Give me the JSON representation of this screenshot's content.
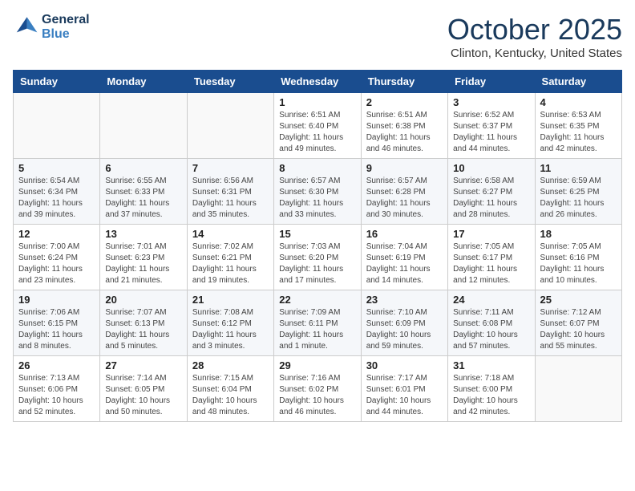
{
  "logo": {
    "line1": "General",
    "line2": "Blue"
  },
  "title": "October 2025",
  "subtitle": "Clinton, Kentucky, United States",
  "weekdays": [
    "Sunday",
    "Monday",
    "Tuesday",
    "Wednesday",
    "Thursday",
    "Friday",
    "Saturday"
  ],
  "weeks": [
    [
      {
        "day": "",
        "info": ""
      },
      {
        "day": "",
        "info": ""
      },
      {
        "day": "",
        "info": ""
      },
      {
        "day": "1",
        "info": "Sunrise: 6:51 AM\nSunset: 6:40 PM\nDaylight: 11 hours\nand 49 minutes."
      },
      {
        "day": "2",
        "info": "Sunrise: 6:51 AM\nSunset: 6:38 PM\nDaylight: 11 hours\nand 46 minutes."
      },
      {
        "day": "3",
        "info": "Sunrise: 6:52 AM\nSunset: 6:37 PM\nDaylight: 11 hours\nand 44 minutes."
      },
      {
        "day": "4",
        "info": "Sunrise: 6:53 AM\nSunset: 6:35 PM\nDaylight: 11 hours\nand 42 minutes."
      }
    ],
    [
      {
        "day": "5",
        "info": "Sunrise: 6:54 AM\nSunset: 6:34 PM\nDaylight: 11 hours\nand 39 minutes."
      },
      {
        "day": "6",
        "info": "Sunrise: 6:55 AM\nSunset: 6:33 PM\nDaylight: 11 hours\nand 37 minutes."
      },
      {
        "day": "7",
        "info": "Sunrise: 6:56 AM\nSunset: 6:31 PM\nDaylight: 11 hours\nand 35 minutes."
      },
      {
        "day": "8",
        "info": "Sunrise: 6:57 AM\nSunset: 6:30 PM\nDaylight: 11 hours\nand 33 minutes."
      },
      {
        "day": "9",
        "info": "Sunrise: 6:57 AM\nSunset: 6:28 PM\nDaylight: 11 hours\nand 30 minutes."
      },
      {
        "day": "10",
        "info": "Sunrise: 6:58 AM\nSunset: 6:27 PM\nDaylight: 11 hours\nand 28 minutes."
      },
      {
        "day": "11",
        "info": "Sunrise: 6:59 AM\nSunset: 6:25 PM\nDaylight: 11 hours\nand 26 minutes."
      }
    ],
    [
      {
        "day": "12",
        "info": "Sunrise: 7:00 AM\nSunset: 6:24 PM\nDaylight: 11 hours\nand 23 minutes."
      },
      {
        "day": "13",
        "info": "Sunrise: 7:01 AM\nSunset: 6:23 PM\nDaylight: 11 hours\nand 21 minutes."
      },
      {
        "day": "14",
        "info": "Sunrise: 7:02 AM\nSunset: 6:21 PM\nDaylight: 11 hours\nand 19 minutes."
      },
      {
        "day": "15",
        "info": "Sunrise: 7:03 AM\nSunset: 6:20 PM\nDaylight: 11 hours\nand 17 minutes."
      },
      {
        "day": "16",
        "info": "Sunrise: 7:04 AM\nSunset: 6:19 PM\nDaylight: 11 hours\nand 14 minutes."
      },
      {
        "day": "17",
        "info": "Sunrise: 7:05 AM\nSunset: 6:17 PM\nDaylight: 11 hours\nand 12 minutes."
      },
      {
        "day": "18",
        "info": "Sunrise: 7:05 AM\nSunset: 6:16 PM\nDaylight: 11 hours\nand 10 minutes."
      }
    ],
    [
      {
        "day": "19",
        "info": "Sunrise: 7:06 AM\nSunset: 6:15 PM\nDaylight: 11 hours\nand 8 minutes."
      },
      {
        "day": "20",
        "info": "Sunrise: 7:07 AM\nSunset: 6:13 PM\nDaylight: 11 hours\nand 5 minutes."
      },
      {
        "day": "21",
        "info": "Sunrise: 7:08 AM\nSunset: 6:12 PM\nDaylight: 11 hours\nand 3 minutes."
      },
      {
        "day": "22",
        "info": "Sunrise: 7:09 AM\nSunset: 6:11 PM\nDaylight: 11 hours\nand 1 minute."
      },
      {
        "day": "23",
        "info": "Sunrise: 7:10 AM\nSunset: 6:09 PM\nDaylight: 10 hours\nand 59 minutes."
      },
      {
        "day": "24",
        "info": "Sunrise: 7:11 AM\nSunset: 6:08 PM\nDaylight: 10 hours\nand 57 minutes."
      },
      {
        "day": "25",
        "info": "Sunrise: 7:12 AM\nSunset: 6:07 PM\nDaylight: 10 hours\nand 55 minutes."
      }
    ],
    [
      {
        "day": "26",
        "info": "Sunrise: 7:13 AM\nSunset: 6:06 PM\nDaylight: 10 hours\nand 52 minutes."
      },
      {
        "day": "27",
        "info": "Sunrise: 7:14 AM\nSunset: 6:05 PM\nDaylight: 10 hours\nand 50 minutes."
      },
      {
        "day": "28",
        "info": "Sunrise: 7:15 AM\nSunset: 6:04 PM\nDaylight: 10 hours\nand 48 minutes."
      },
      {
        "day": "29",
        "info": "Sunrise: 7:16 AM\nSunset: 6:02 PM\nDaylight: 10 hours\nand 46 minutes."
      },
      {
        "day": "30",
        "info": "Sunrise: 7:17 AM\nSunset: 6:01 PM\nDaylight: 10 hours\nand 44 minutes."
      },
      {
        "day": "31",
        "info": "Sunrise: 7:18 AM\nSunset: 6:00 PM\nDaylight: 10 hours\nand 42 minutes."
      },
      {
        "day": "",
        "info": ""
      }
    ]
  ]
}
